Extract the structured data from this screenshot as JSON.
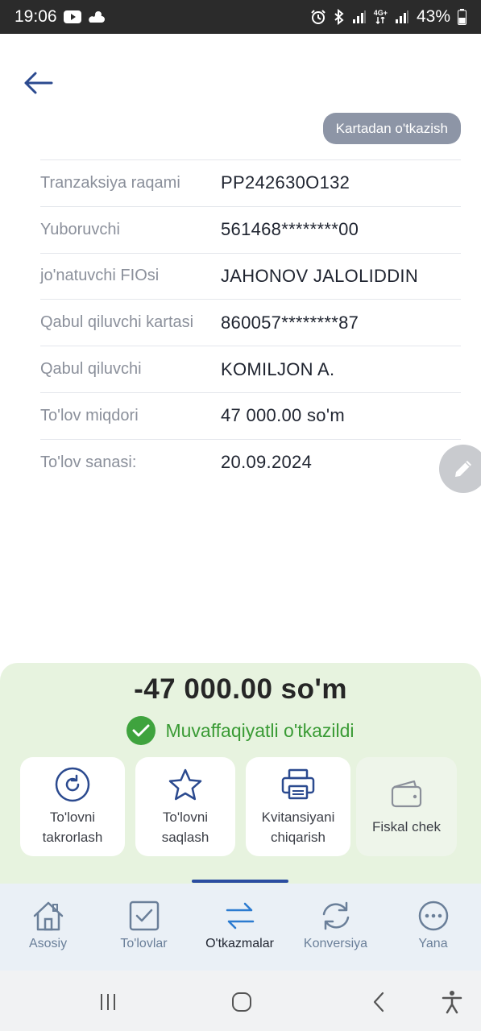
{
  "status_bar": {
    "time": "19:06",
    "network_label_top": "4G+",
    "battery": "43%",
    "icons": [
      "youtube-icon",
      "weather-icon",
      "alarm-icon",
      "bluetooth-icon",
      "signal-icon",
      "battery-icon"
    ]
  },
  "header": {
    "transfer_type": "Kartadan o'tkazish"
  },
  "details": [
    {
      "label": "Tranzaksiya raqami",
      "value": "PP242630O132"
    },
    {
      "label": "Yuboruvchi",
      "value": "561468********00"
    },
    {
      "label": "jo'natuvchi FIOsi",
      "value": "JAHONOV JALOLIDDIN"
    },
    {
      "label": "Qabul qiluvchi kartasi",
      "value": "860057********87"
    },
    {
      "label": "Qabul qiluvchi",
      "value": "KOMILJON A."
    },
    {
      "label": "To'lov miqdori",
      "value": "47 000.00 so'm"
    },
    {
      "label": "To'lov sanasi:",
      "value": "20.09.2024"
    }
  ],
  "result": {
    "amount": "-47 000.00 so'm",
    "status": "Muvaffaqiyatli o'tkazildi"
  },
  "actions": [
    {
      "line1": "To'lovni",
      "line2": "takrorlash"
    },
    {
      "line1": "To'lovni",
      "line2": "saqlash"
    },
    {
      "line1": "Kvitansiyani",
      "line2": "chiqarish"
    },
    {
      "line1": "Fiskal chek",
      "line2": ""
    }
  ],
  "nav": [
    {
      "label": "Asosiy"
    },
    {
      "label": "To'lovlar"
    },
    {
      "label": "O'tkazmalar"
    },
    {
      "label": "Konversiya"
    },
    {
      "label": "Yana"
    }
  ],
  "colors": {
    "accent": "#2b4da1",
    "success": "#3fa33e",
    "panel_bg": "#e7f3df",
    "chip_bg": "#8d95a6",
    "nav_bg": "#eaf0f6"
  }
}
